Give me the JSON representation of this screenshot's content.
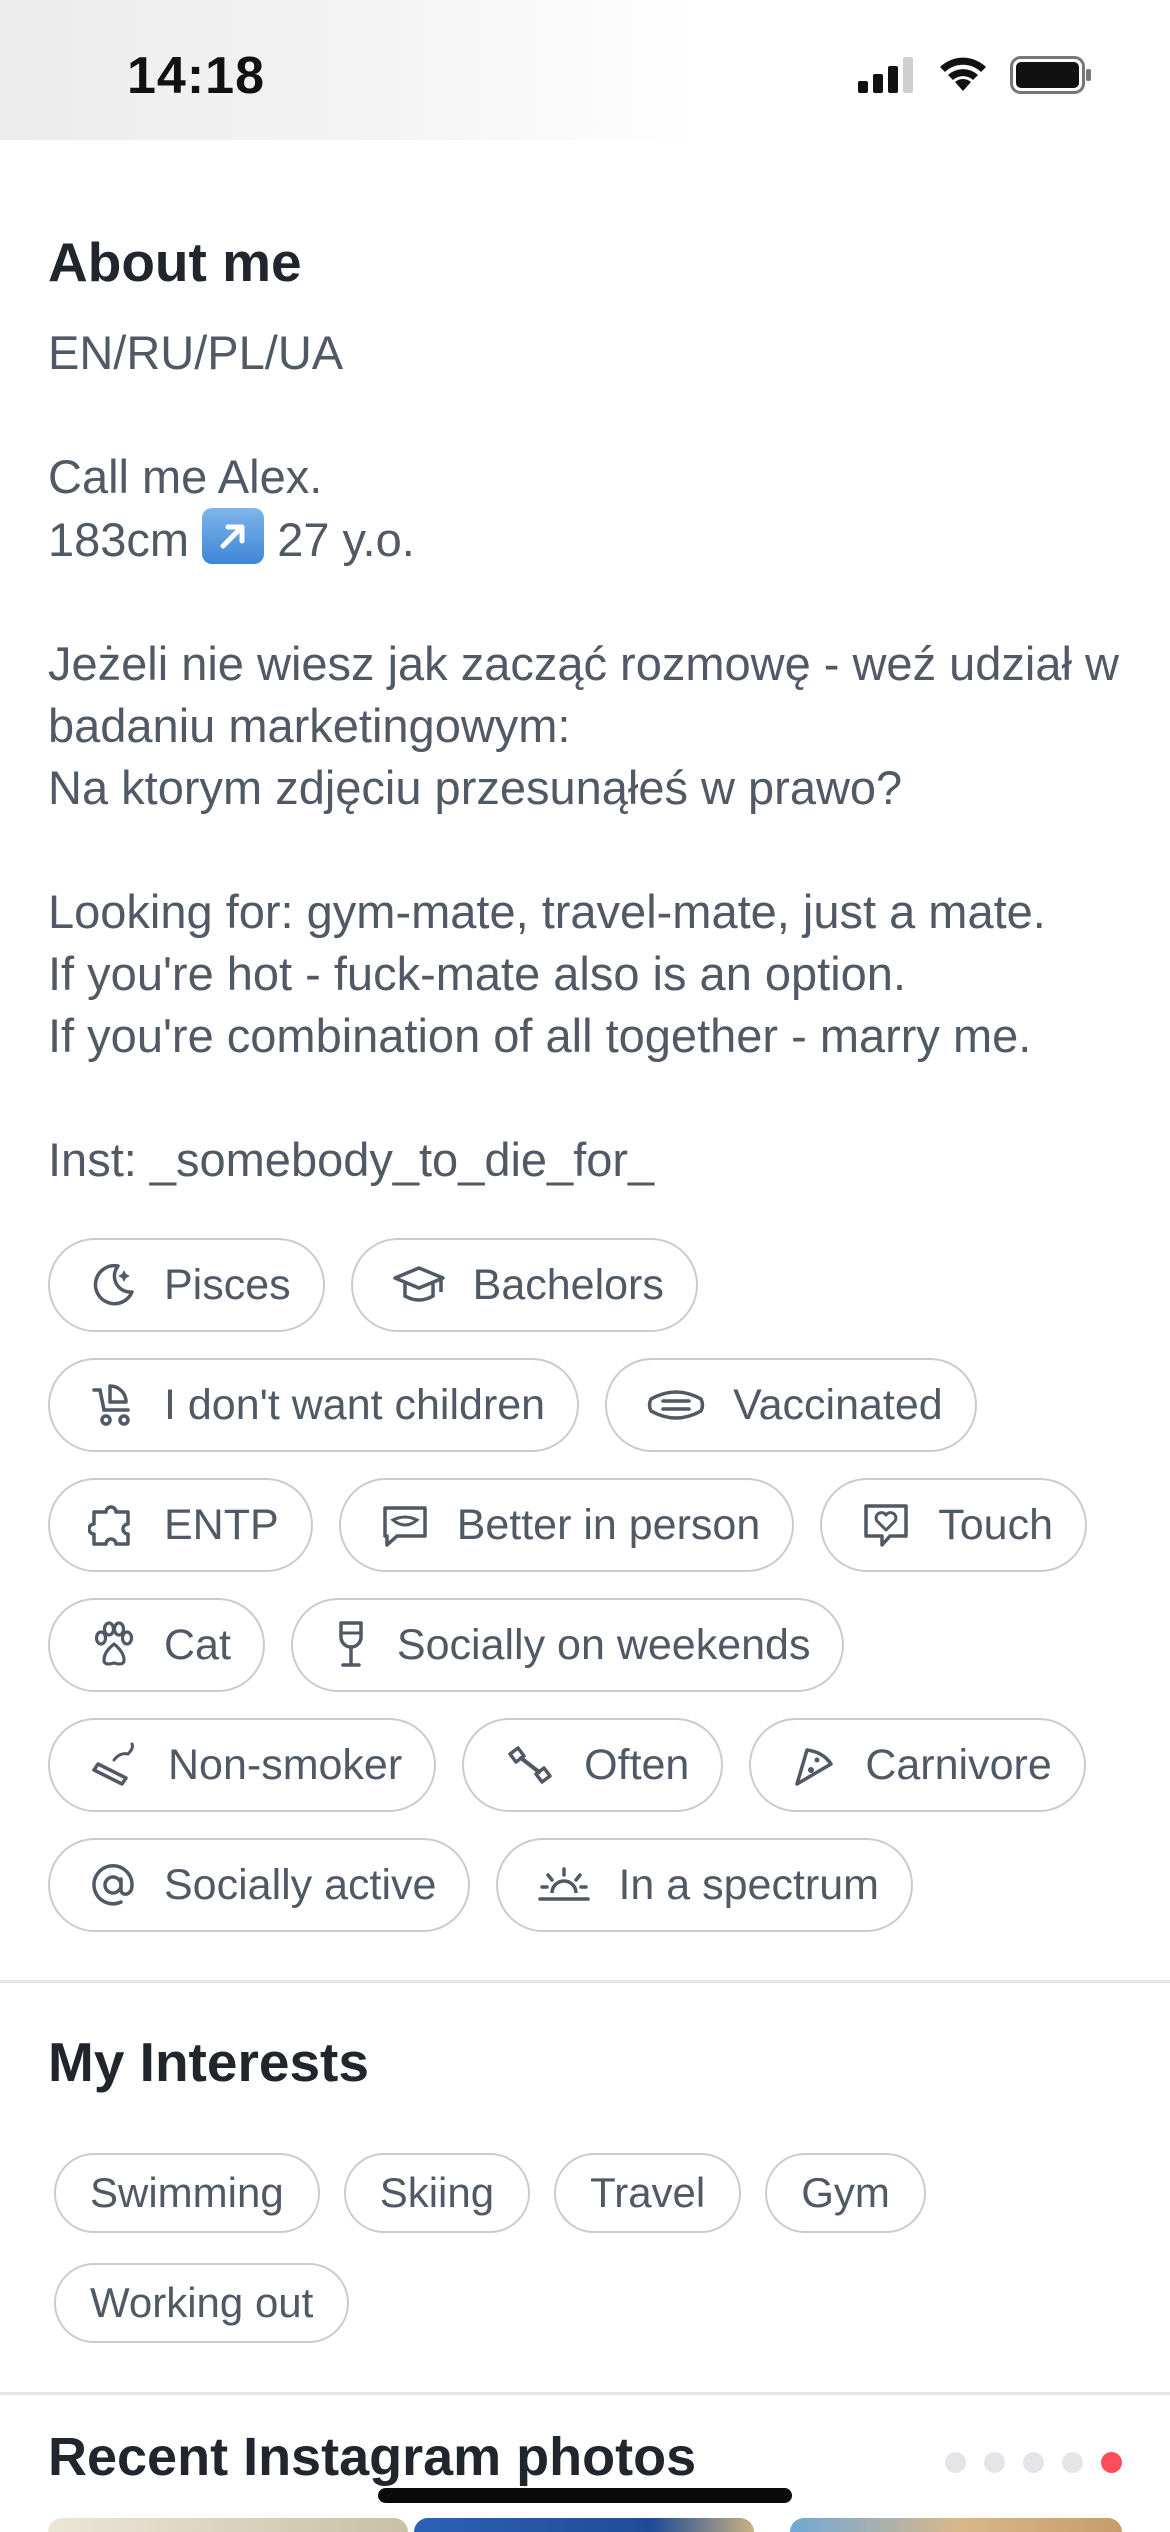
{
  "status": {
    "time": "14:18"
  },
  "about": {
    "title": "About me",
    "bio_line1": "EN/RU/PL/UA",
    "bio_line2": "Call me Alex.",
    "bio_height": "183cm",
    "bio_age": "27 y.o.",
    "bio_polish": "Jeżeli nie wiesz jak zacząć rozmowę - weź udział w badaniu marketingowym:\nNa ktorym zdjęciu przesunąłeś w prawo?",
    "bio_looking": "Looking for: gym-mate, travel-mate, just a mate.\nIf you're hot - fuck-mate also is an option.\nIf you're combination of all together - marry me.",
    "bio_inst": "Inst: _somebody_to_die_for_"
  },
  "attributes": [
    {
      "icon": "moon-icon",
      "label": "Pisces"
    },
    {
      "icon": "graduation-cap-icon",
      "label": "Bachelors"
    },
    {
      "icon": "stroller-icon",
      "label": "I don't want children"
    },
    {
      "icon": "mask-icon",
      "label": "Vaccinated"
    },
    {
      "icon": "puzzle-icon",
      "label": "ENTP"
    },
    {
      "icon": "speech-bubble-icon",
      "label": "Better in person"
    },
    {
      "icon": "heart-bubble-icon",
      "label": "Touch"
    },
    {
      "icon": "paw-icon",
      "label": "Cat"
    },
    {
      "icon": "wine-glass-icon",
      "label": "Socially on weekends"
    },
    {
      "icon": "cigarette-icon",
      "label": "Non-smoker"
    },
    {
      "icon": "dumbbell-icon",
      "label": "Often"
    },
    {
      "icon": "pizza-icon",
      "label": "Carnivore"
    },
    {
      "icon": "at-icon",
      "label": "Socially active"
    },
    {
      "icon": "sunrise-icon",
      "label": "In a spectrum"
    }
  ],
  "interests": {
    "title": "My Interests",
    "items": [
      "Swimming",
      "Skiing",
      "Travel",
      "Gym",
      "Working out"
    ]
  },
  "instagram": {
    "title": "Recent Instagram photos",
    "page_count": 5,
    "active_page": 5
  },
  "colors": {
    "accent_dot": "#fd4d5c",
    "text_primary": "#21262e",
    "text_secondary": "#505965",
    "chip_border": "#c8ccd1"
  }
}
